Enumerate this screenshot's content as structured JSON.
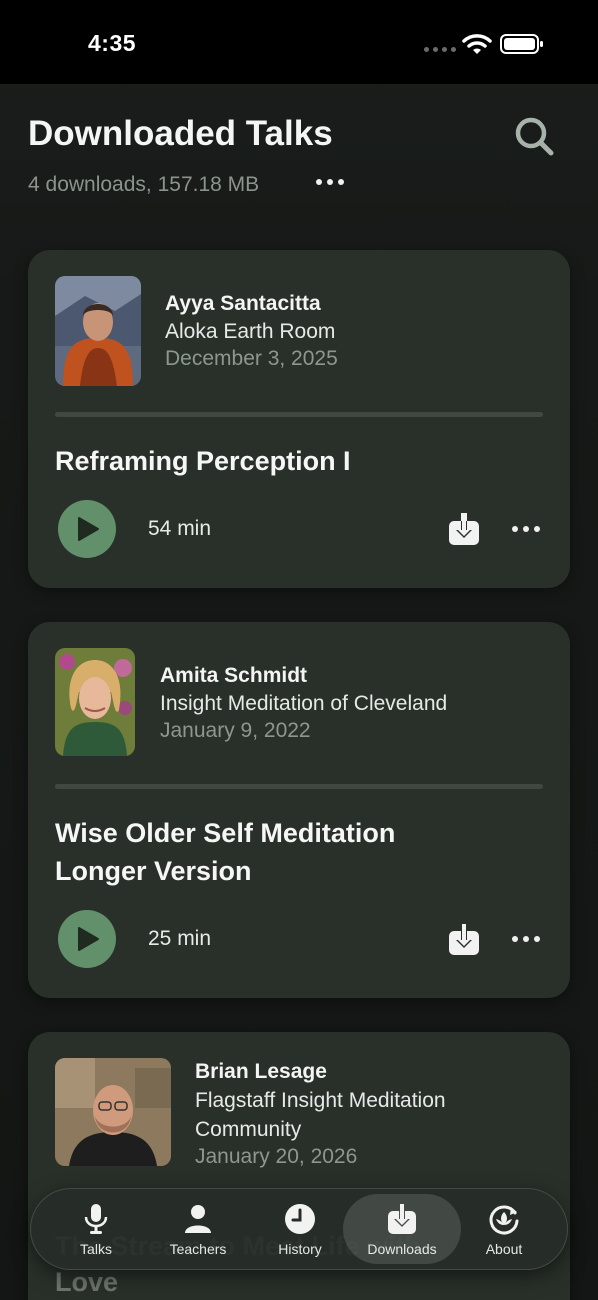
{
  "status_bar": {
    "time": "4:35"
  },
  "header": {
    "title": "Downloaded Talks",
    "subtitle": "4 downloads, 157.18 MB"
  },
  "talks": [
    {
      "teacher": "Ayya Santacitta",
      "venue": "Aloka Earth Room",
      "date": "December 3, 2025",
      "title": "Reframing Perception I",
      "duration": "54 min"
    },
    {
      "teacher": "Amita Schmidt",
      "venue": "Insight Meditation of Cleveland",
      "date": "January 9, 2022",
      "title": "Wise Older Self Meditation Longer Version",
      "duration": "25 min"
    },
    {
      "teacher": "Brian Lesage",
      "venue": "Flagstaff Insight Meditation Community",
      "date": "January 20, 2026",
      "title": "The Stream to Meet Life with Love"
    }
  ],
  "tabs": [
    {
      "label": "Talks",
      "icon": "microphone-icon"
    },
    {
      "label": "Teachers",
      "icon": "person-icon"
    },
    {
      "label": "History",
      "icon": "clock-icon"
    },
    {
      "label": "Downloads",
      "icon": "download-tray-icon",
      "active": true
    },
    {
      "label": "About",
      "icon": "refresh-lotus-icon"
    }
  ],
  "colors": {
    "background": "#151816",
    "card": "#293029",
    "accent_green": "#62906a",
    "muted_text": "#8d978f"
  }
}
